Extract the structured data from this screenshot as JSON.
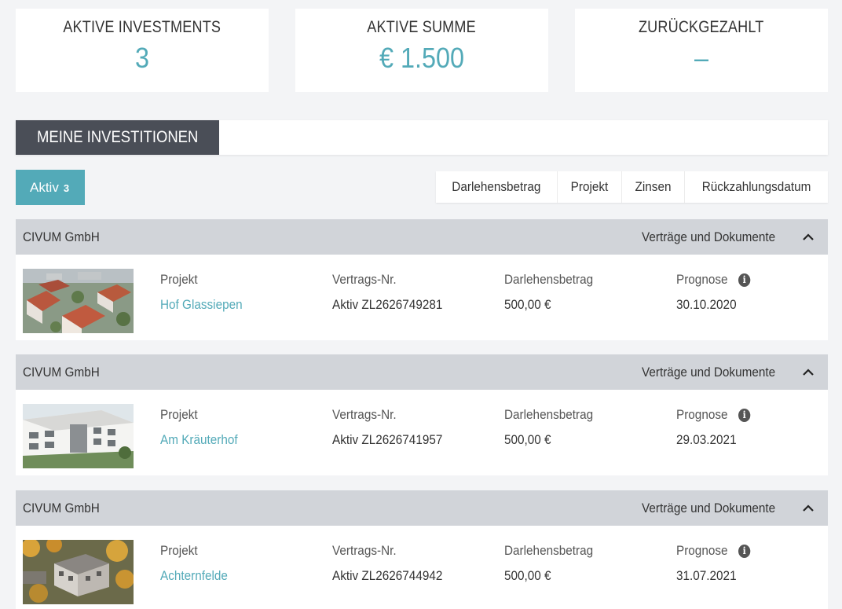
{
  "stats": [
    {
      "label": "AKTIVE INVESTMENTS",
      "value": "3"
    },
    {
      "label": "AKTIVE SUMME",
      "value": "€ 1.500"
    },
    {
      "label": "ZURÜCKGEZAHLT",
      "value": "–"
    }
  ],
  "section": {
    "title": "MEINE INVESTITIONEN"
  },
  "filter": {
    "tab_label": "Aktiv",
    "tab_count": "3"
  },
  "sort": [
    "Darlehensbetrag",
    "Projekt",
    "Zinsen",
    "Rückzahlungsdatum"
  ],
  "columns": {
    "project": "Projekt",
    "contract": "Vertrags-Nr.",
    "amount": "Darlehensbetrag",
    "forecast": "Prognose"
  },
  "investments": [
    {
      "company": "CIVUM GmbH",
      "docs_label": "Verträge und Dokumente",
      "project": "Hof Glassiepen",
      "contract": "Aktiv ZL2626749281",
      "amount": "500,00 €",
      "forecast": "30.10.2020",
      "thumb": "aerial-town"
    },
    {
      "company": "CIVUM GmbH",
      "docs_label": "Verträge und Dokumente",
      "project": "Am Kräuterhof",
      "contract": "Aktiv ZL2626741957",
      "amount": "500,00 €",
      "forecast": "29.03.2021",
      "thumb": "white-building"
    },
    {
      "company": "CIVUM GmbH",
      "docs_label": "Verträge und Dokumente",
      "project": "Achternfelde",
      "contract": "Aktiv ZL2626744942",
      "amount": "500,00 €",
      "forecast": "31.07.2021",
      "thumb": "autumn-aerial"
    }
  ],
  "colors": {
    "accent": "#53aab8",
    "dark": "#4a4e57",
    "header_gray": "#d1d4d9"
  }
}
